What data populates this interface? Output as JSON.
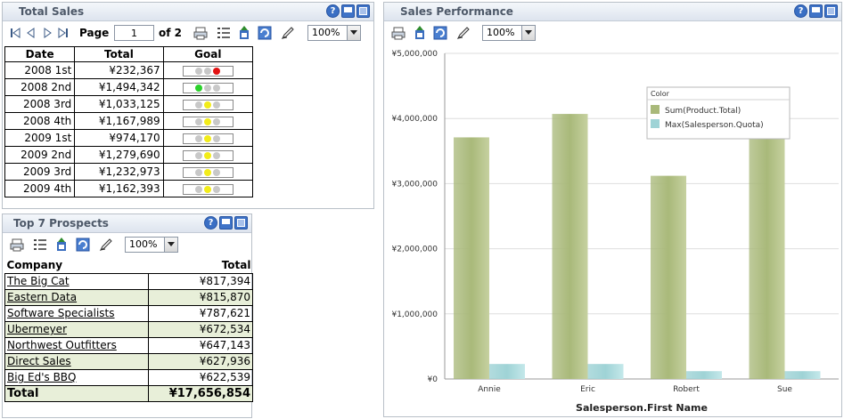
{
  "total_sales": {
    "title": "Total Sales",
    "page_label": "Page",
    "page_value": "1",
    "page_of": "of 2",
    "zoom": "100%",
    "columns": [
      "Date",
      "Total",
      "Goal"
    ],
    "rows": [
      {
        "date": "2008 1st",
        "total": "¥232,367",
        "light": "red"
      },
      {
        "date": "2008 2nd",
        "total": "¥1,494,342",
        "light": "green"
      },
      {
        "date": "2008 3rd",
        "total": "¥1,033,125",
        "light": "yellow"
      },
      {
        "date": "2008 4th",
        "total": "¥1,167,989",
        "light": "yellow"
      },
      {
        "date": "2009 1st",
        "total": "¥974,170",
        "light": "yellow"
      },
      {
        "date": "2009 2nd",
        "total": "¥1,279,690",
        "light": "yellow"
      },
      {
        "date": "2009 3rd",
        "total": "¥1,232,973",
        "light": "yellow"
      },
      {
        "date": "2009 4th",
        "total": "¥1,162,393",
        "light": "yellow"
      }
    ]
  },
  "top_prospects": {
    "title": "Top 7 Prospects",
    "zoom": "100%",
    "col_company": "Company",
    "col_total": "Total",
    "rows": [
      {
        "company": "The Big Cat",
        "total": "¥817,394"
      },
      {
        "company": "Eastern Data",
        "total": "¥815,870"
      },
      {
        "company": "Software Specialists",
        "total": "¥787,621"
      },
      {
        "company": "Ubermeyer",
        "total": "¥672,534"
      },
      {
        "company": "Northwest Outfitters",
        "total": "¥647,143"
      },
      {
        "company": "Direct Sales",
        "total": "¥627,936"
      },
      {
        "company": "Big Ed's BBQ",
        "total": "¥622,539"
      }
    ],
    "footer_label": "Total",
    "footer_total": "¥17,656,854"
  },
  "sales_performance": {
    "title": "Sales Performance",
    "zoom": "100%"
  },
  "colors": {
    "series1": "#a9b97a",
    "series2": "#9fd3d6",
    "header_title": "#4d5868"
  },
  "chart_data": {
    "type": "bar",
    "categories": [
      "Annie",
      "Eric",
      "Robert",
      "Sue"
    ],
    "series": [
      {
        "name": "Sum(Product.Total)",
        "values": [
          3710000,
          4070000,
          3120000,
          3950000
        ]
      },
      {
        "name": "Max(Salesperson.Quota)",
        "values": [
          230000,
          230000,
          120000,
          120000
        ]
      }
    ],
    "ylim": [
      0,
      5000000
    ],
    "yticks": [
      0,
      1000000,
      2000000,
      3000000,
      4000000,
      5000000
    ],
    "ytick_labels": [
      "¥0",
      "¥1,000,000",
      "¥2,000,000",
      "¥3,000,000",
      "¥4,000,000",
      "¥5,000,000"
    ],
    "xlabel": "Salesperson.First Name",
    "ylabel": "",
    "legend_title": "Color",
    "legend_position": "top-right",
    "grid": true
  }
}
